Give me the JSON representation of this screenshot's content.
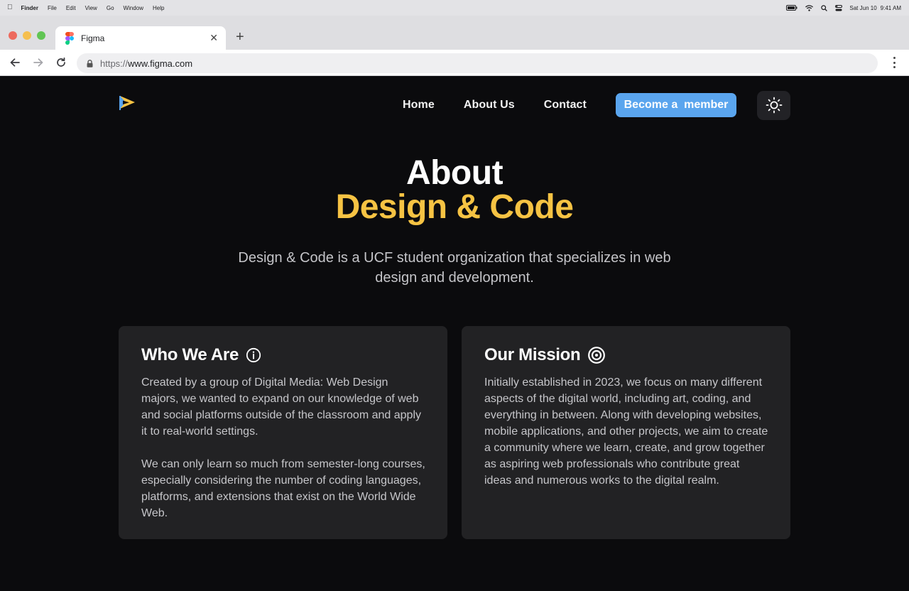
{
  "menubar": {
    "app": "Finder",
    "items": [
      "File",
      "Edit",
      "View",
      "Go",
      "Window",
      "Help"
    ],
    "date": "Sat Jun 10",
    "time": "9:41 AM",
    "icons": [
      "battery-icon",
      "wifi-icon",
      "spotlight-search-icon",
      "control-center-icon"
    ]
  },
  "browser": {
    "tab_title": "Figma",
    "url_scheme": "https://",
    "url_host": "www.figma.com"
  },
  "site": {
    "nav": {
      "links": [
        "Home",
        "About Us",
        "Contact"
      ],
      "cta": "Become a  member",
      "theme_toggle_icon": "sun-icon"
    },
    "hero": {
      "title_line1": "About",
      "title_line2": "Design & Code",
      "subtitle": "Design & Code is a UCF student organization that specializes in web design and development."
    },
    "cards": [
      {
        "title": "Who We Are",
        "icon": "info-circle-icon",
        "paragraphs": [
          "Created by a group of Digital Media: Web Design majors, we wanted to expand on our knowledge of web and social platforms outside of the classroom and apply it to real-world settings.",
          "We can only learn so much from semester-long courses, especially considering the number of coding languages, platforms, and extensions that exist on the World Wide Web."
        ]
      },
      {
        "title": "Our Mission",
        "icon": "target-icon",
        "paragraphs": [
          "Initially established in 2023, we focus on many different aspects of the digital world, including art, coding, and everything in between. Along with developing websites, mobile applications, and other projects, we aim to create a community where we learn, create, and grow together as aspiring web professionals who contribute great ideas and numerous works to the digital realm."
        ]
      }
    ],
    "colors": {
      "background": "#0b0b0d",
      "accent_yellow": "#f6c343",
      "accent_blue": "#5aa5ee",
      "card": "#222224"
    }
  }
}
